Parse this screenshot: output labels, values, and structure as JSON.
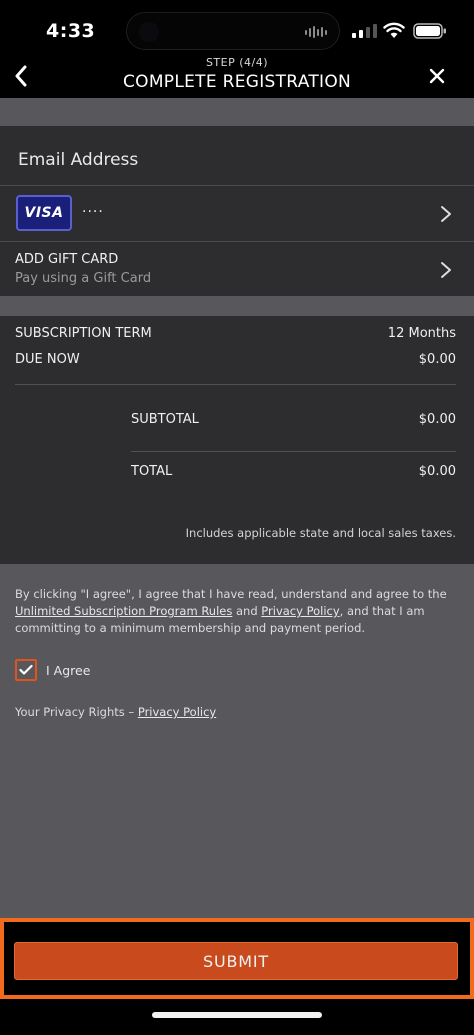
{
  "status_bar": {
    "time": "4:33"
  },
  "header": {
    "step": "STEP (4/4)",
    "title": "COMPLETE REGISTRATION",
    "back_icon": "chevron-left-icon",
    "close_icon": "close-icon"
  },
  "payment": {
    "email_label": "Email Address",
    "card_brand": "VISA",
    "card_masked": "····",
    "gift_card_title": "ADD GIFT CARD",
    "gift_card_subtitle": "Pay using a Gift Card"
  },
  "summary": {
    "term_label": "SUBSCRIPTION TERM",
    "term_value": "12 Months",
    "due_label": "DUE NOW",
    "due_value": "$0.00",
    "subtotal_label": "SUBTOTAL",
    "subtotal_value": "$0.00",
    "total_label": "TOTAL",
    "total_value": "$0.00",
    "tax_note": "Includes applicable state and local sales taxes."
  },
  "legal": {
    "text_1": "By clicking \"I agree\", I agree that I have read, understand and agree to the",
    "rules_link": "Unlimited Subscription Program Rules",
    "and": "and",
    "privacy_link": "Privacy Policy",
    "text_2": ", and that I am committing to a minimum membership and payment period.",
    "agree_label": "I Agree",
    "agree_checked": true,
    "privacy_rights": "Your Privacy Rights – ",
    "privacy_rights_link": "Privacy Policy"
  },
  "footer": {
    "submit_label": "SUBMIT"
  },
  "colors": {
    "accent": "#c94a1c",
    "highlight": "#f26a1b",
    "card_bg": "#2d2d30",
    "page_bg": "#58585c"
  }
}
